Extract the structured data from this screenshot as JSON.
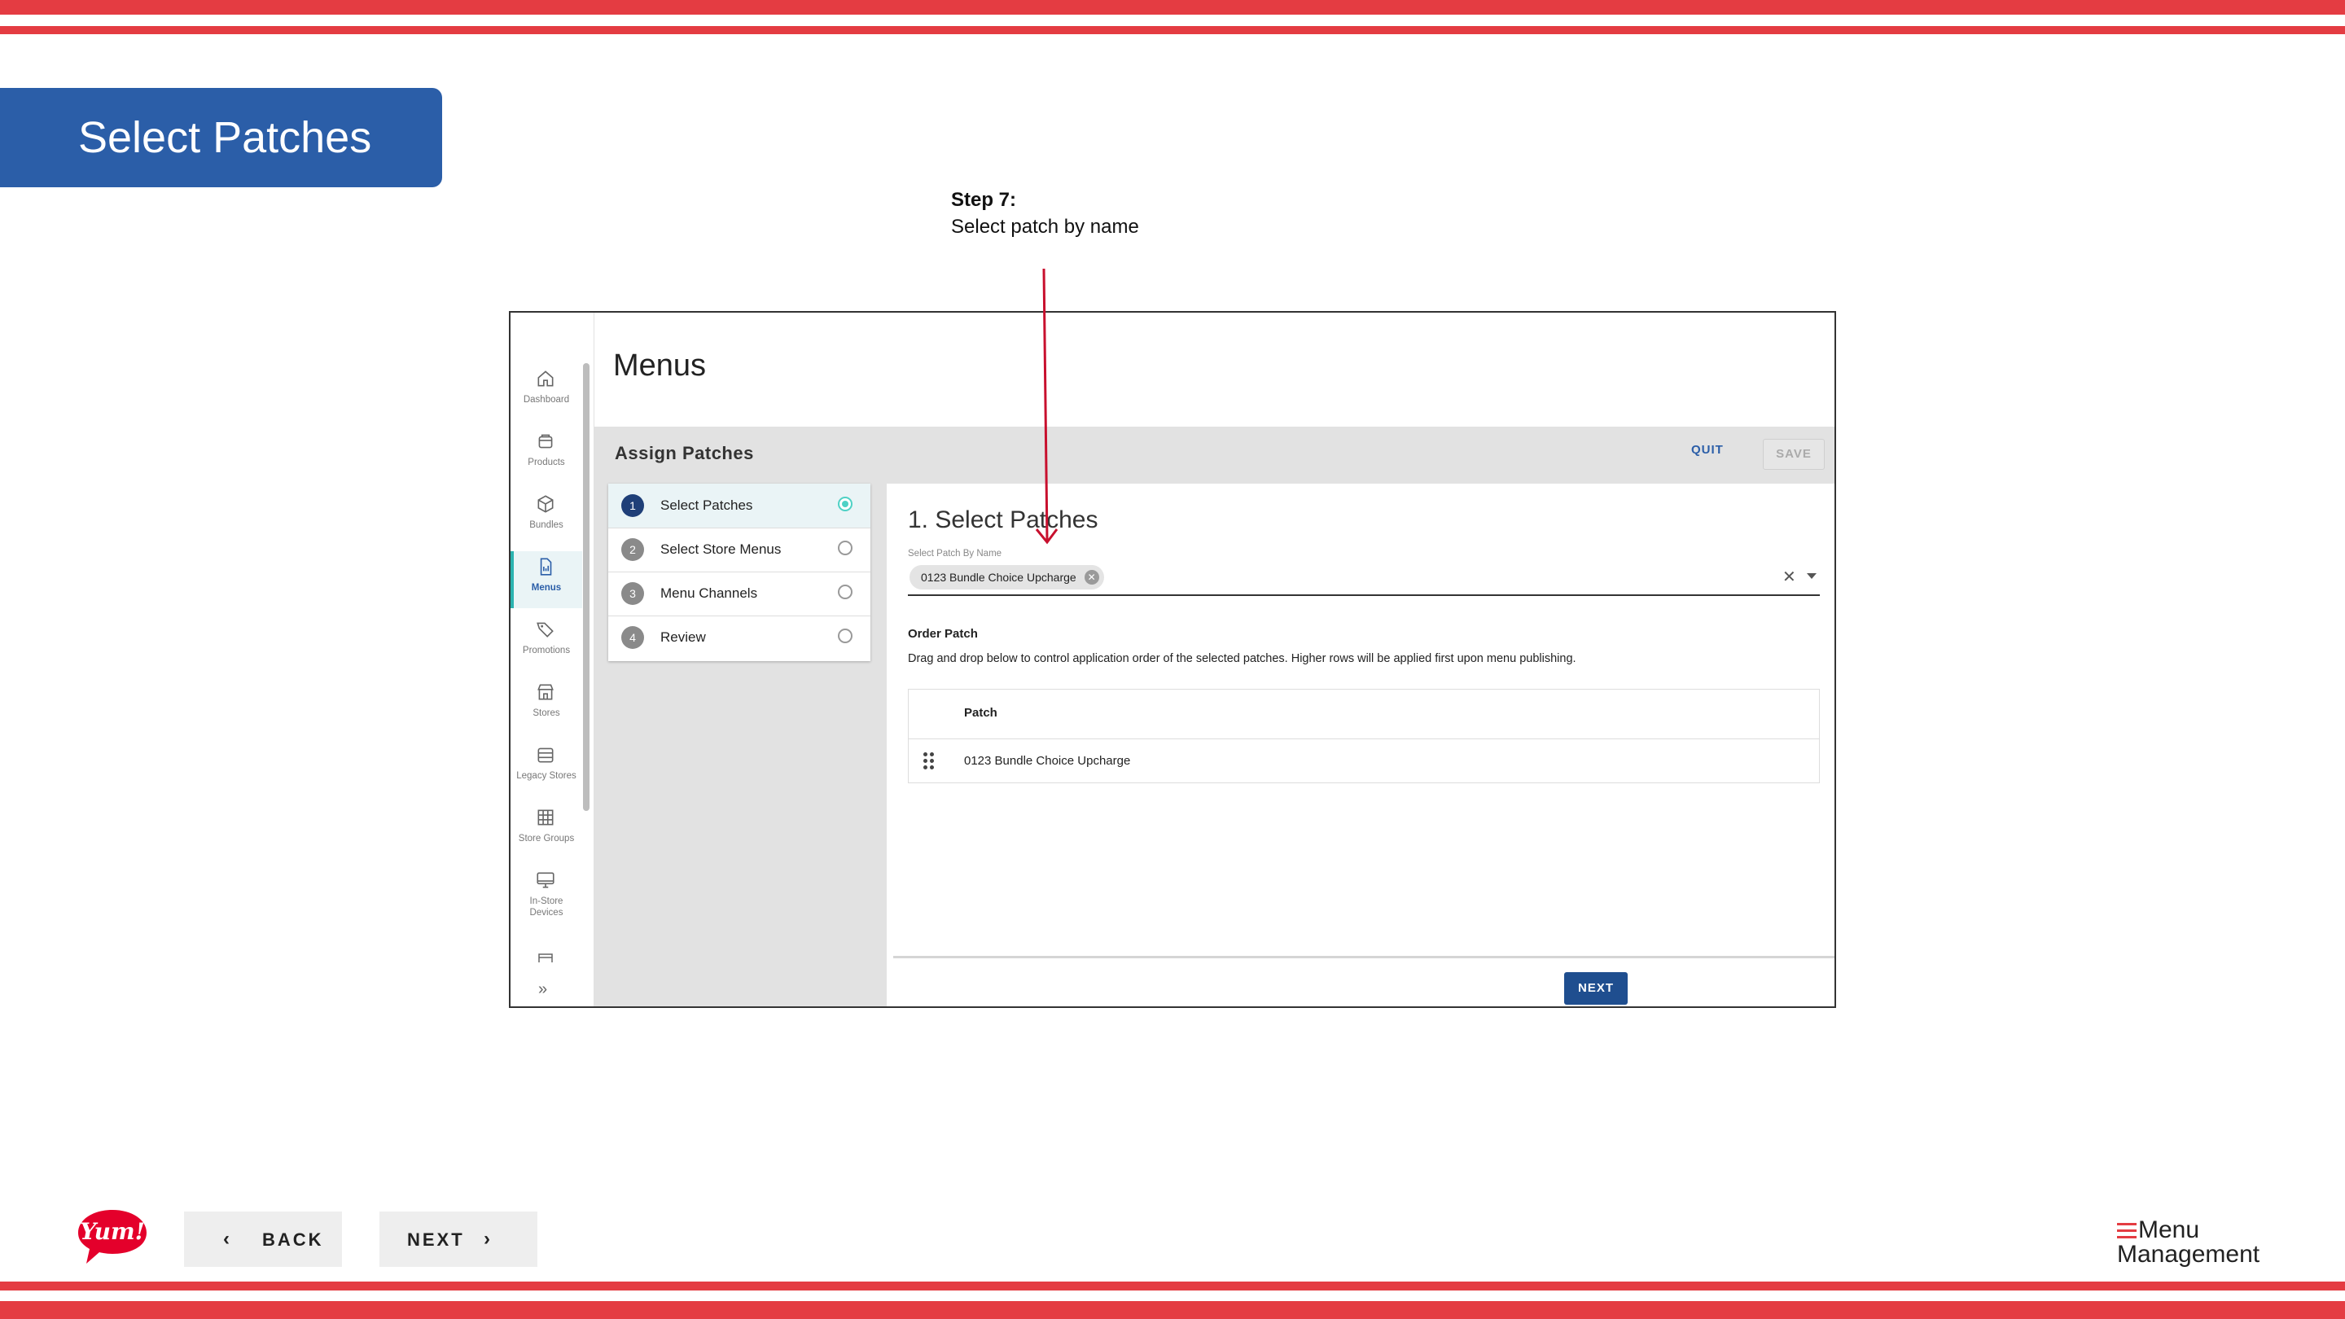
{
  "slide": {
    "title": "Select Patches",
    "step_title": "Step 7:",
    "step_desc": "Select patch by name",
    "back_label": "BACK",
    "next_label": "NEXT",
    "logo_text": "Yum!",
    "brand_line1": "Menu",
    "brand_line2": "Management"
  },
  "app": {
    "title": "Menus",
    "sidebar": {
      "items": [
        {
          "label": "Dashboard",
          "icon": "home-icon"
        },
        {
          "label": "Products",
          "icon": "box-icon"
        },
        {
          "label": "Bundles",
          "icon": "cube-icon"
        },
        {
          "label": "Menus",
          "icon": "document-icon",
          "active": true
        },
        {
          "label": "Promotions",
          "icon": "tag-icon"
        },
        {
          "label": "Stores",
          "icon": "store-icon"
        },
        {
          "label": "Legacy Stores",
          "icon": "legacy-store-icon"
        },
        {
          "label": "Store Groups",
          "icon": "grid-icon"
        },
        {
          "label": "In-Store Devices",
          "icon": "monitor-icon"
        }
      ]
    },
    "assign": {
      "title": "Assign Patches",
      "quit_label": "QUIT",
      "save_label": "SAVE"
    },
    "steps": [
      {
        "num": "1",
        "label": "Select Patches",
        "active": true
      },
      {
        "num": "2",
        "label": "Select Store Menus"
      },
      {
        "num": "3",
        "label": "Menu Channels"
      },
      {
        "num": "4",
        "label": "Review"
      }
    ],
    "panel": {
      "title": "1. Select Patches",
      "field_label": "Select Patch By Name",
      "chip_value": "0123 Bundle Choice Upcharge",
      "order_title": "Order Patch",
      "order_desc": "Drag and drop below to control application order of the selected patches. Higher rows will be applied first upon menu publishing.",
      "table_header": "Patch",
      "rows": [
        "0123 Bundle Choice Upcharge"
      ],
      "next_label": "NEXT"
    }
  },
  "colors": {
    "stripe": "#e43c42",
    "title_box": "#2b5ea8",
    "primary": "#1f4e8f",
    "accent": "#4fd1c5",
    "arrow": "#c8102e"
  }
}
